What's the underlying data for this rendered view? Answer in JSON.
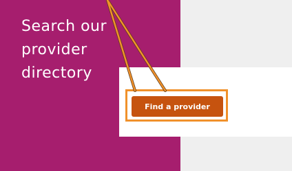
{
  "panel": {
    "heading": "Search our provider directory"
  },
  "cta": {
    "find_provider_label": "Find a provider"
  },
  "colors": {
    "panel_bg": "#a61e6e",
    "button_bg": "#c6530f",
    "highlight": "#f0912b",
    "page_bg": "#efefef"
  }
}
